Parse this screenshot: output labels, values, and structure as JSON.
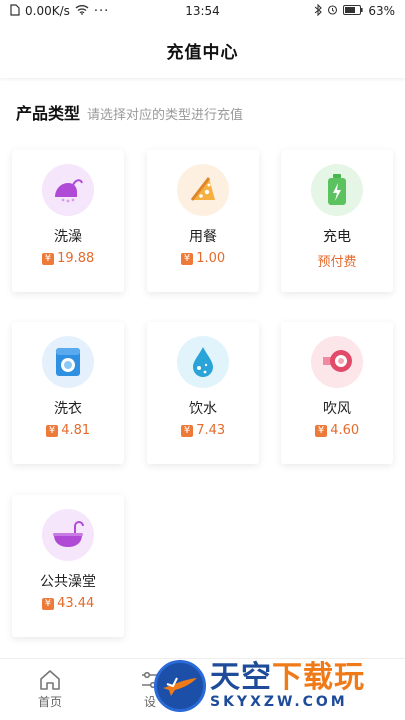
{
  "status_bar": {
    "speed": "0.00K/s",
    "time": "13:54",
    "battery": "63%"
  },
  "nav": {
    "title": "充值中心"
  },
  "section": {
    "title": "产品类型",
    "hint": "请选择对应的类型进行充值"
  },
  "products": [
    {
      "name": "洗澡",
      "price": "19.88",
      "icon": "shower-icon",
      "color": "#b04ad6",
      "bg": "#f5e6fb"
    },
    {
      "name": "用餐",
      "price": "1.00",
      "icon": "pizza-icon",
      "color": "#f09a2a",
      "bg": "#fdf0e1"
    },
    {
      "name": "充电",
      "price_text": "预付费",
      "icon": "battery-icon",
      "color": "#46b54a",
      "bg": "#e6f6e6"
    },
    {
      "name": "洗衣",
      "price": "4.81",
      "icon": "washer-icon",
      "color": "#2f8fe0",
      "bg": "#e4f1fc"
    },
    {
      "name": "饮水",
      "price": "7.43",
      "icon": "water-drop-icon",
      "color": "#2aa3d8",
      "bg": "#e1f3fb"
    },
    {
      "name": "吹风",
      "price": "4.60",
      "icon": "hair-dryer-icon",
      "color": "#e24a6a",
      "bg": "#fde6ea"
    },
    {
      "name": "公共澡堂",
      "price": "43.44",
      "icon": "bathtub-icon",
      "color": "#b04ad6",
      "bg": "#f5e6fb"
    }
  ],
  "currency_symbol": "¥",
  "tabs": [
    {
      "label": "首页"
    },
    {
      "label": "设"
    }
  ],
  "watermark": {
    "title_a": "天空",
    "title_b": "下载玩",
    "sub": "SKYXZW.COM"
  }
}
